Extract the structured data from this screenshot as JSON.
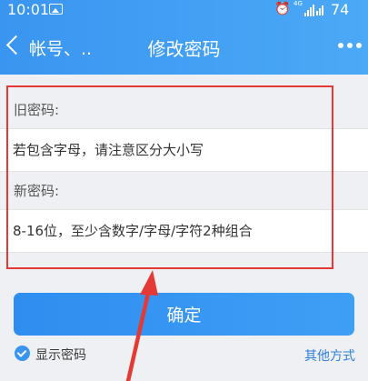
{
  "status_bar": {
    "time": "10:01",
    "network_label": "4G",
    "battery": "74",
    "icons": [
      "image-icon",
      "alarm-icon",
      "signal-icon",
      "wifi-icon"
    ]
  },
  "nav": {
    "back_label": "帐号、..",
    "title": "修改密码",
    "more_icon": "more-icon"
  },
  "form": {
    "old_password": {
      "label": "旧密码:",
      "placeholder": "若包含字母，请注意区分大小写"
    },
    "new_password": {
      "label": "新密码:",
      "placeholder": "8-16位，至少含数字/字母/字符2种组合"
    }
  },
  "actions": {
    "confirm_label": "确定",
    "show_password_label": "显示密码",
    "show_password_checked": true,
    "other_methods_label": "其他方式"
  },
  "colors": {
    "accent": "#3a95f0",
    "annotation": "#e53935",
    "link": "#2f80d8"
  }
}
